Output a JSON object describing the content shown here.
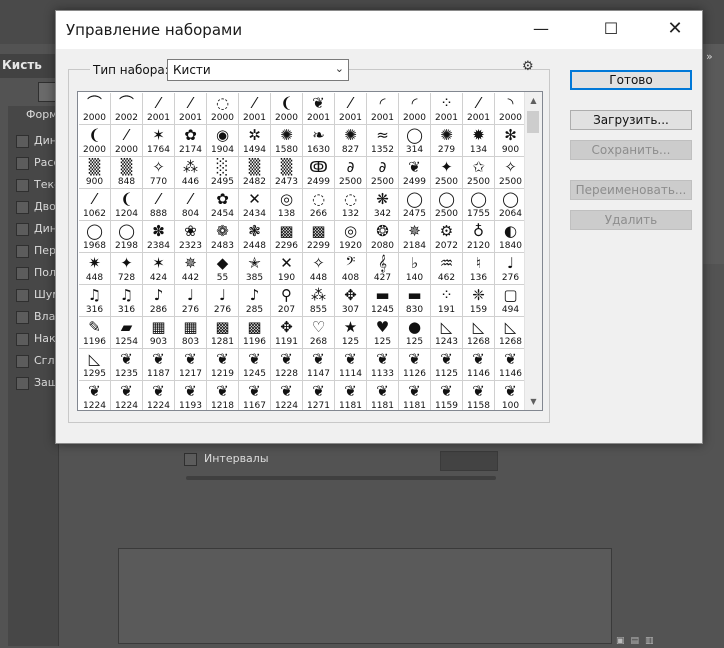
{
  "background_panel": {
    "tab_label": "Кисть",
    "list_header": "Форм",
    "settings": [
      "Дина",
      "Расс",
      "Текс",
      "Двой",
      "Дина",
      "Пер",
      "Пол",
      "Шум",
      "Влаж",
      "Нак",
      "Сгла",
      "Защ"
    ],
    "interval_label": "Интервалы"
  },
  "dialog": {
    "title": "Управление наборами",
    "type_label": "Тип набора:",
    "type_value": "Кисти",
    "buttons": {
      "done": "Готово",
      "load": "Загрузить...",
      "save": "Сохранить...",
      "rename": "Переименовать...",
      "delete": "Удалить"
    }
  },
  "brushes": [
    {
      "icon": "⌒",
      "size": "2000"
    },
    {
      "icon": "⌒",
      "size": "2002"
    },
    {
      "icon": "⁄",
      "size": "2001"
    },
    {
      "icon": "⁄",
      "size": "2001"
    },
    {
      "icon": "◌",
      "size": "2000"
    },
    {
      "icon": "⁄",
      "size": "2001"
    },
    {
      "icon": "❨",
      "size": "2000"
    },
    {
      "icon": "❦",
      "size": "2001"
    },
    {
      "icon": "⁄",
      "size": "2001"
    },
    {
      "icon": "◜",
      "size": "2001"
    },
    {
      "icon": "◜",
      "size": "2000"
    },
    {
      "icon": "⁘",
      "size": "2001"
    },
    {
      "icon": "⁄",
      "size": "2001"
    },
    {
      "icon": "◝",
      "size": "2000"
    },
    {
      "icon": "❨",
      "size": "2000"
    },
    {
      "icon": "⁄",
      "size": "2000"
    },
    {
      "icon": "✶",
      "size": "1764"
    },
    {
      "icon": "✿",
      "size": "2174"
    },
    {
      "icon": "◉",
      "size": "1904"
    },
    {
      "icon": "✲",
      "size": "1494"
    },
    {
      "icon": "✺",
      "size": "1580"
    },
    {
      "icon": "❧",
      "size": "1630"
    },
    {
      "icon": "✺",
      "size": "827"
    },
    {
      "icon": "≈",
      "size": "1352"
    },
    {
      "icon": "◯",
      "size": "314"
    },
    {
      "icon": "✺",
      "size": "279"
    },
    {
      "icon": "✹",
      "size": "134"
    },
    {
      "icon": "✻",
      "size": "900"
    },
    {
      "icon": "▒",
      "size": "900"
    },
    {
      "icon": "▒",
      "size": "848"
    },
    {
      "icon": "✧",
      "size": "770"
    },
    {
      "icon": "⁂",
      "size": "446"
    },
    {
      "icon": "░",
      "size": "2495"
    },
    {
      "icon": "▒",
      "size": "2482"
    },
    {
      "icon": "▒",
      "size": "2473"
    },
    {
      "icon": "ↂ",
      "size": "2499"
    },
    {
      "icon": "∂",
      "size": "2500"
    },
    {
      "icon": "∂",
      "size": "2500"
    },
    {
      "icon": "❦",
      "size": "2499"
    },
    {
      "icon": "✦",
      "size": "2500"
    },
    {
      "icon": "✩",
      "size": "2500"
    },
    {
      "icon": "✧",
      "size": "2500"
    },
    {
      "icon": "⁄",
      "size": "1062"
    },
    {
      "icon": "❨",
      "size": "1204"
    },
    {
      "icon": "⁄",
      "size": "888"
    },
    {
      "icon": "⁄",
      "size": "804"
    },
    {
      "icon": "✿",
      "size": "2454"
    },
    {
      "icon": "✕",
      "size": "2434"
    },
    {
      "icon": "◎",
      "size": "138"
    },
    {
      "icon": "◌",
      "size": "266"
    },
    {
      "icon": "◌",
      "size": "132"
    },
    {
      "icon": "❋",
      "size": "342"
    },
    {
      "icon": "◯",
      "size": "2475"
    },
    {
      "icon": "◯",
      "size": "2500"
    },
    {
      "icon": "◯",
      "size": "1755"
    },
    {
      "icon": "◯",
      "size": "2064"
    },
    {
      "icon": "◯",
      "size": "1968"
    },
    {
      "icon": "◯",
      "size": "2198"
    },
    {
      "icon": "✽",
      "size": "2384"
    },
    {
      "icon": "❀",
      "size": "2323"
    },
    {
      "icon": "❁",
      "size": "2483"
    },
    {
      "icon": "❃",
      "size": "2448"
    },
    {
      "icon": "▩",
      "size": "2296"
    },
    {
      "icon": "▩",
      "size": "2299"
    },
    {
      "icon": "◎",
      "size": "1920"
    },
    {
      "icon": "❂",
      "size": "2080"
    },
    {
      "icon": "✵",
      "size": "2184"
    },
    {
      "icon": "⚙",
      "size": "2072"
    },
    {
      "icon": "♁",
      "size": "2120"
    },
    {
      "icon": "◐",
      "size": "1840"
    },
    {
      "icon": "✷",
      "size": "448"
    },
    {
      "icon": "✦",
      "size": "728"
    },
    {
      "icon": "✶",
      "size": "424"
    },
    {
      "icon": "✵",
      "size": "442"
    },
    {
      "icon": "◆",
      "size": "55"
    },
    {
      "icon": "✭",
      "size": "385"
    },
    {
      "icon": "✕",
      "size": "190"
    },
    {
      "icon": "✧",
      "size": "448"
    },
    {
      "icon": "𝄢",
      "size": "408"
    },
    {
      "icon": "𝄞",
      "size": "427"
    },
    {
      "icon": "♭",
      "size": "140"
    },
    {
      "icon": "♒",
      "size": "462"
    },
    {
      "icon": "♮",
      "size": "136"
    },
    {
      "icon": "♩",
      "size": "276"
    },
    {
      "icon": "♫",
      "size": "316"
    },
    {
      "icon": "♫",
      "size": "316"
    },
    {
      "icon": "♪",
      "size": "286"
    },
    {
      "icon": "♩",
      "size": "276"
    },
    {
      "icon": "♩",
      "size": "276"
    },
    {
      "icon": "♪",
      "size": "285"
    },
    {
      "icon": "⚲",
      "size": "207"
    },
    {
      "icon": "⁂",
      "size": "855"
    },
    {
      "icon": "✥",
      "size": "307"
    },
    {
      "icon": "▬",
      "size": "1245"
    },
    {
      "icon": "▬",
      "size": "830"
    },
    {
      "icon": "⁘",
      "size": "191"
    },
    {
      "icon": "❈",
      "size": "159"
    },
    {
      "icon": "▢",
      "size": "494"
    },
    {
      "icon": "✎",
      "size": "1196"
    },
    {
      "icon": "▰",
      "size": "1254"
    },
    {
      "icon": "▦",
      "size": "903"
    },
    {
      "icon": "▦",
      "size": "803"
    },
    {
      "icon": "▩",
      "size": "1281"
    },
    {
      "icon": "▩",
      "size": "1196"
    },
    {
      "icon": "✥",
      "size": "1191"
    },
    {
      "icon": "♡",
      "size": "268"
    },
    {
      "icon": "★",
      "size": "125"
    },
    {
      "icon": "♥",
      "size": "125"
    },
    {
      "icon": "●",
      "size": "125"
    },
    {
      "icon": "◺",
      "size": "1243"
    },
    {
      "icon": "◺",
      "size": "1268"
    },
    {
      "icon": "◺",
      "size": "1268"
    },
    {
      "icon": "◺",
      "size": "1295"
    },
    {
      "icon": "❦",
      "size": "1235"
    },
    {
      "icon": "❦",
      "size": "1187"
    },
    {
      "icon": "❦",
      "size": "1217"
    },
    {
      "icon": "❦",
      "size": "1219"
    },
    {
      "icon": "❦",
      "size": "1245"
    },
    {
      "icon": "❦",
      "size": "1228"
    },
    {
      "icon": "❦",
      "size": "1147"
    },
    {
      "icon": "❦",
      "size": "1114"
    },
    {
      "icon": "❦",
      "size": "1133"
    },
    {
      "icon": "❦",
      "size": "1126"
    },
    {
      "icon": "❦",
      "size": "1125"
    },
    {
      "icon": "❦",
      "size": "1146"
    },
    {
      "icon": "❦",
      "size": "1146"
    },
    {
      "icon": "❦",
      "size": "1224"
    },
    {
      "icon": "❦",
      "size": "1224"
    },
    {
      "icon": "❦",
      "size": "1224"
    },
    {
      "icon": "❦",
      "size": "1193"
    },
    {
      "icon": "❦",
      "size": "1218"
    },
    {
      "icon": "❦",
      "size": "1167"
    },
    {
      "icon": "❦",
      "size": "1224"
    },
    {
      "icon": "❦",
      "size": "1271"
    },
    {
      "icon": "❦",
      "size": "1181"
    },
    {
      "icon": "❦",
      "size": "1181"
    },
    {
      "icon": "❦",
      "size": "1181"
    },
    {
      "icon": "❦",
      "size": "1159"
    },
    {
      "icon": "❦",
      "size": "1158"
    },
    {
      "icon": "❦",
      "size": "100"
    }
  ]
}
